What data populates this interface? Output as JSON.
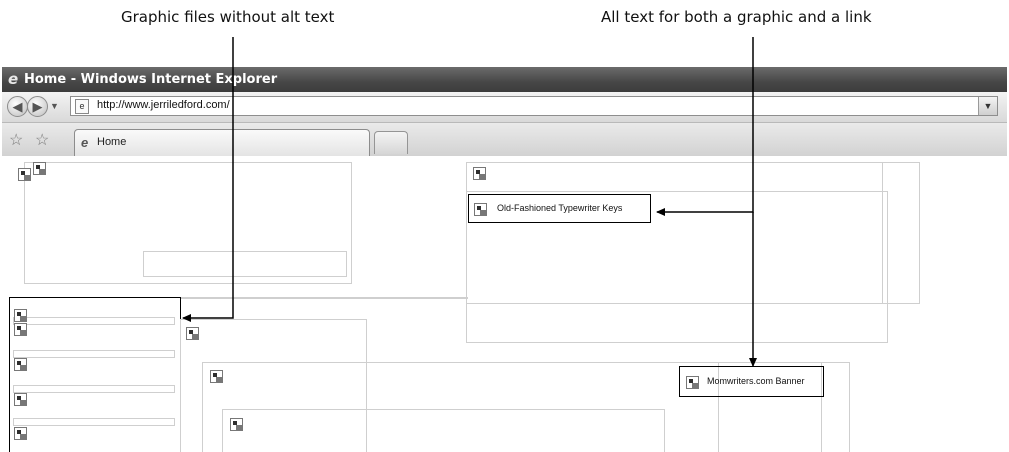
{
  "callouts": {
    "left": "Graphic files without alt text",
    "right": "All text for both a graphic and a link"
  },
  "browser": {
    "title": "Home - Windows Internet Explorer",
    "address_url": "http://www.jerriledford.com/",
    "tab_label": "Home"
  },
  "page": {
    "alt_texts": {
      "typewriter": "Old-Fashioned Typewriter Keys",
      "banner": "Momwriters.com Banner"
    }
  }
}
